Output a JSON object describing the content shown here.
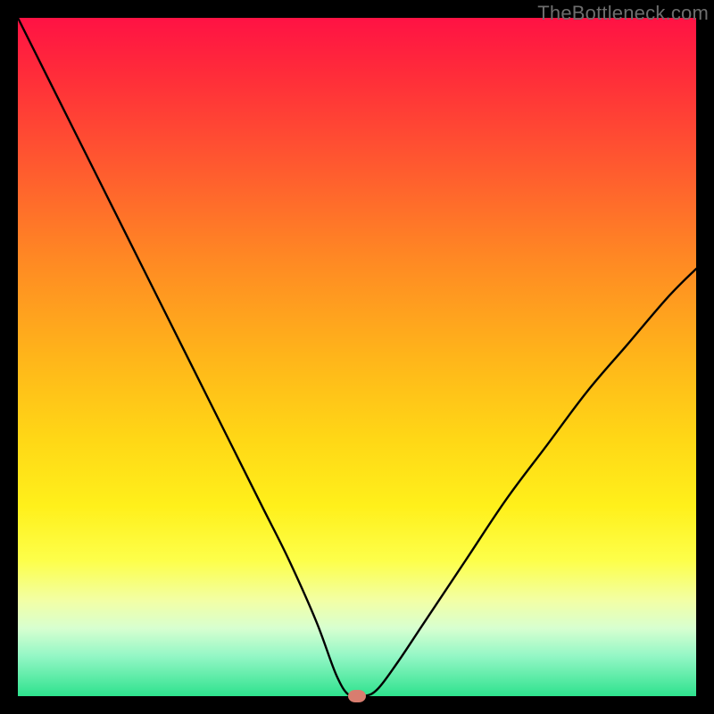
{
  "watermark": "TheBottleneck.com",
  "chart_data": {
    "type": "line",
    "title": "",
    "xlabel": "",
    "ylabel": "",
    "xlim": [
      0,
      100
    ],
    "ylim": [
      0,
      100
    ],
    "grid": false,
    "legend": false,
    "background_gradient": {
      "top": "#ff1244",
      "mid": "#ffe01a",
      "bottom": "#2ee28e"
    },
    "series": [
      {
        "name": "bottleneck-curve",
        "color": "#000000",
        "x": [
          0,
          4,
          8,
          12,
          16,
          20,
          24,
          28,
          32,
          36,
          40,
          44,
          47,
          49,
          51,
          53,
          56,
          60,
          66,
          72,
          78,
          84,
          90,
          96,
          100
        ],
        "y": [
          100,
          92,
          84,
          76,
          68,
          60,
          52,
          44,
          36,
          28,
          20,
          11,
          3,
          0,
          0,
          1,
          5,
          11,
          20,
          29,
          37,
          45,
          52,
          59,
          63
        ]
      }
    ],
    "marker": {
      "name": "optimal-point",
      "x": 50,
      "y": 0,
      "color": "#d87d6f"
    }
  }
}
